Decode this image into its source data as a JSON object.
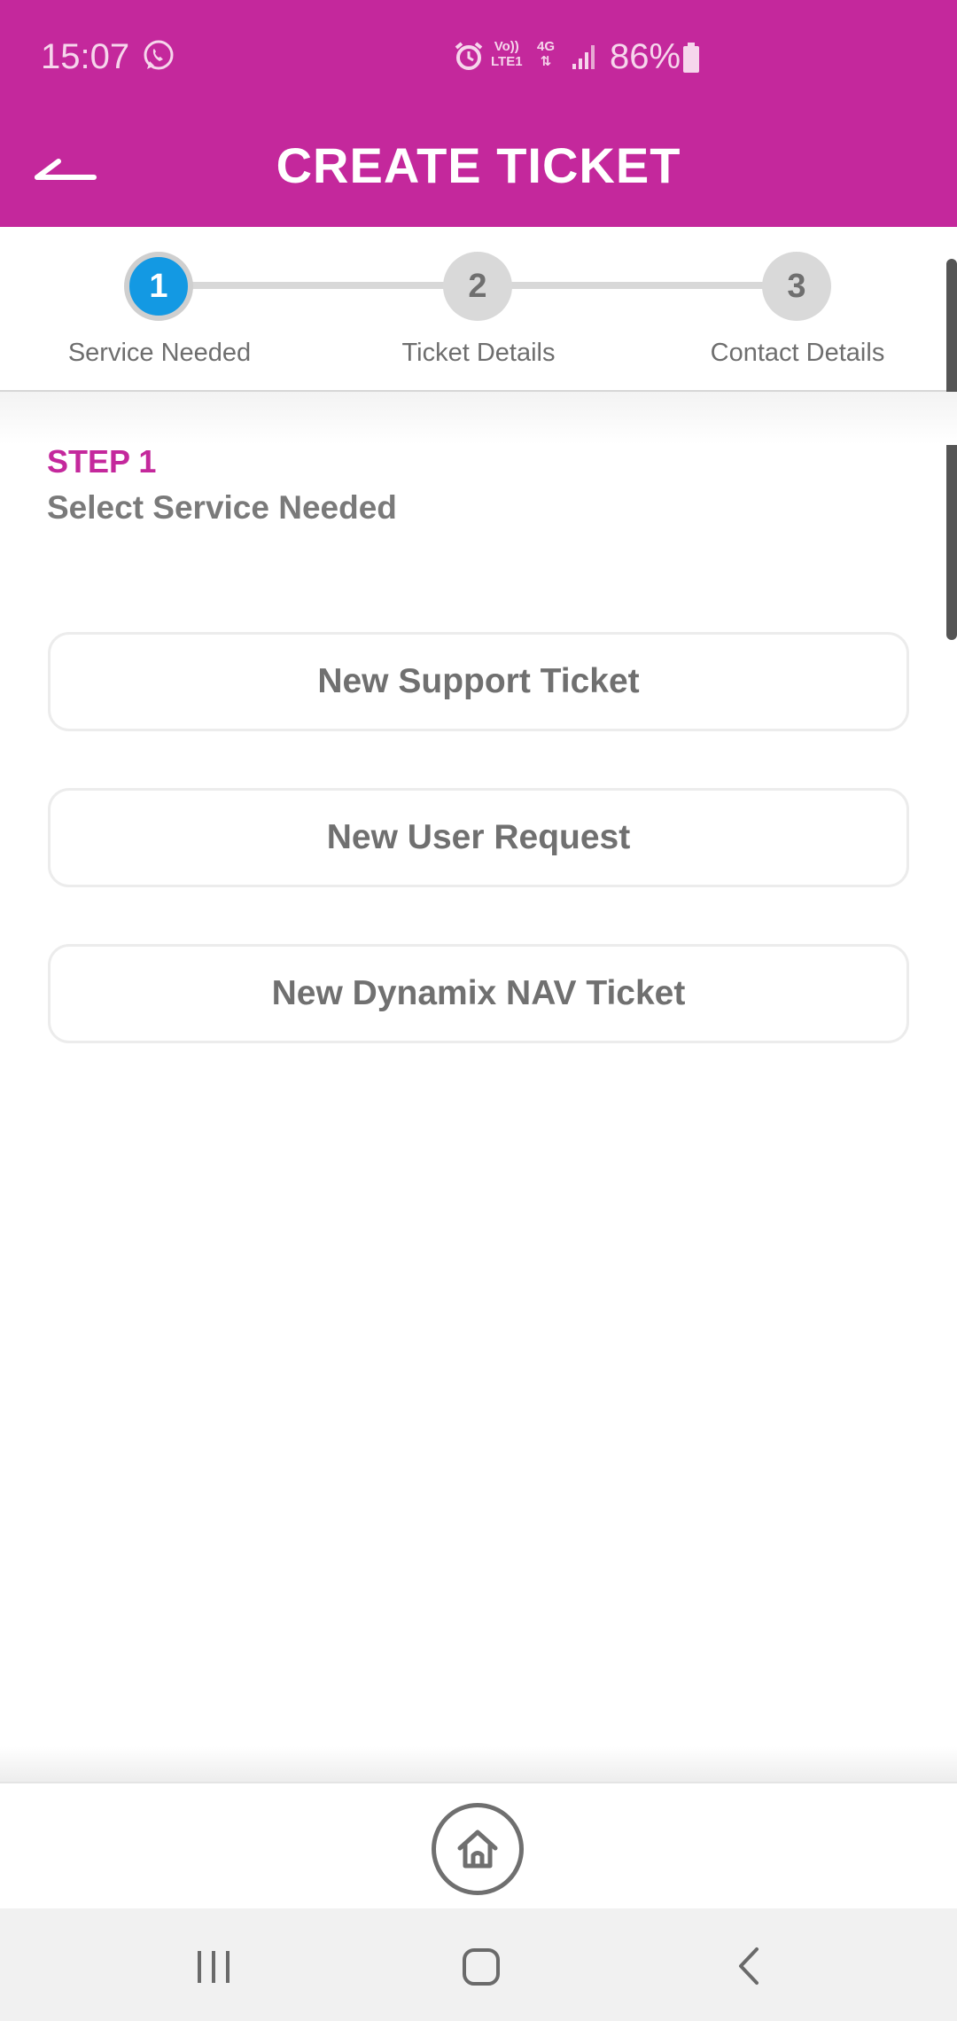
{
  "status_bar": {
    "time": "15:07",
    "battery": "86%",
    "network": "4G",
    "volte": "Vo))",
    "lte": "LTE1",
    "icons": [
      "whatsapp-icon",
      "alarm-icon",
      "volte-icon",
      "network-4g-icon",
      "signal-icon",
      "battery-icon"
    ]
  },
  "app_bar": {
    "title": "CREATE TICKET",
    "back_icon": "back-arrow-icon"
  },
  "stepper": {
    "steps": [
      {
        "number": "1",
        "label": "Service Needed",
        "active": true
      },
      {
        "number": "2",
        "label": "Ticket Details",
        "active": false
      },
      {
        "number": "3",
        "label": "Contact Details",
        "active": false
      }
    ]
  },
  "main": {
    "step_kicker": "STEP 1",
    "step_heading": "Select Service Needed",
    "options": [
      {
        "label": "New Support Ticket"
      },
      {
        "label": "New User Request"
      },
      {
        "label": "New Dynamix NAV Ticket"
      }
    ]
  },
  "bottom_bar": {
    "home_icon": "home-icon"
  },
  "nav_bar": {
    "icons": [
      "recent-apps-icon",
      "home-nav-icon",
      "back-nav-icon"
    ]
  },
  "colors": {
    "brand": "#c4289c",
    "step_active": "#1399e3",
    "text_gray": "#707070"
  }
}
